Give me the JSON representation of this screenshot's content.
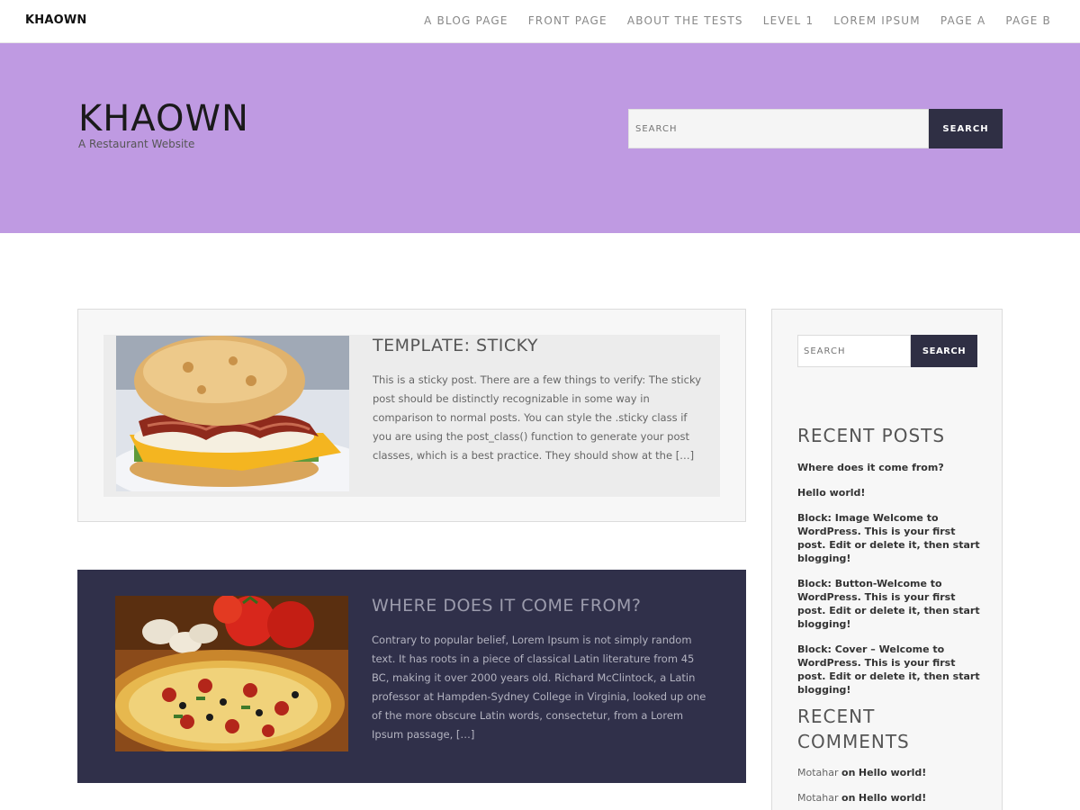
{
  "topbar": {
    "brand": "KHAOWN",
    "nav": [
      "A BLOG PAGE",
      "FRONT PAGE",
      "ABOUT THE TESTS",
      "LEVEL 1",
      "LOREM IPSUM",
      "PAGE A",
      "PAGE B"
    ]
  },
  "hero": {
    "title": "KHAOWN",
    "description": "A Restaurant Website",
    "search_placeholder": "SEARCH",
    "search_button": "SEARCH",
    "bg_color": "#bf9ae2"
  },
  "posts": [
    {
      "title": "TEMPLATE: STICKY",
      "excerpt": "This is a sticky post. There are a few things to verify: The sticky post should be distinctly recognizable in some way in comparison to normal posts. You can style the .sticky class if you are using the post_class() function to generate your post classes, which is a best practice. They should show at the […]",
      "image": "breakfast-sandwich"
    },
    {
      "title": "WHERE DOES IT COME FROM?",
      "excerpt": "Contrary to popular belief, Lorem Ipsum is not simply random text. It has roots in a piece of classical Latin literature from 45 BC, making it over 2000 years old. Richard McClintock, a Latin professor at Hampden-Sydney College in Virginia, looked up one of the more obscure Latin words, consectetur, from a Lorem Ipsum passage, […]",
      "image": "pizza"
    }
  ],
  "sidebar": {
    "search_placeholder": "SEARCH",
    "search_button": "SEARCH",
    "recent_posts_title": "RECENT POSTS",
    "recent_posts": [
      "Where does it come from?",
      "Hello world!",
      "Block: Image Welcome to WordPress. This is your first post. Edit or delete it, then start blogging!",
      "Block: Button-Welcome to WordPress. This is your first post. Edit or delete it, then start blogging!",
      "Block: Cover – Welcome to WordPress. This is your first post. Edit or delete it, then start blogging!"
    ],
    "recent_comments_title": "RECENT COMMENTS",
    "recent_comments": [
      {
        "author": "Motahar",
        "on": "on",
        "post": "Hello world!"
      },
      {
        "author": "Motahar",
        "on": "on",
        "post": "Hello world!"
      }
    ]
  },
  "colors": {
    "accent": "#bf9ae2",
    "dark": "#30304a",
    "button": "#2f2f44"
  }
}
